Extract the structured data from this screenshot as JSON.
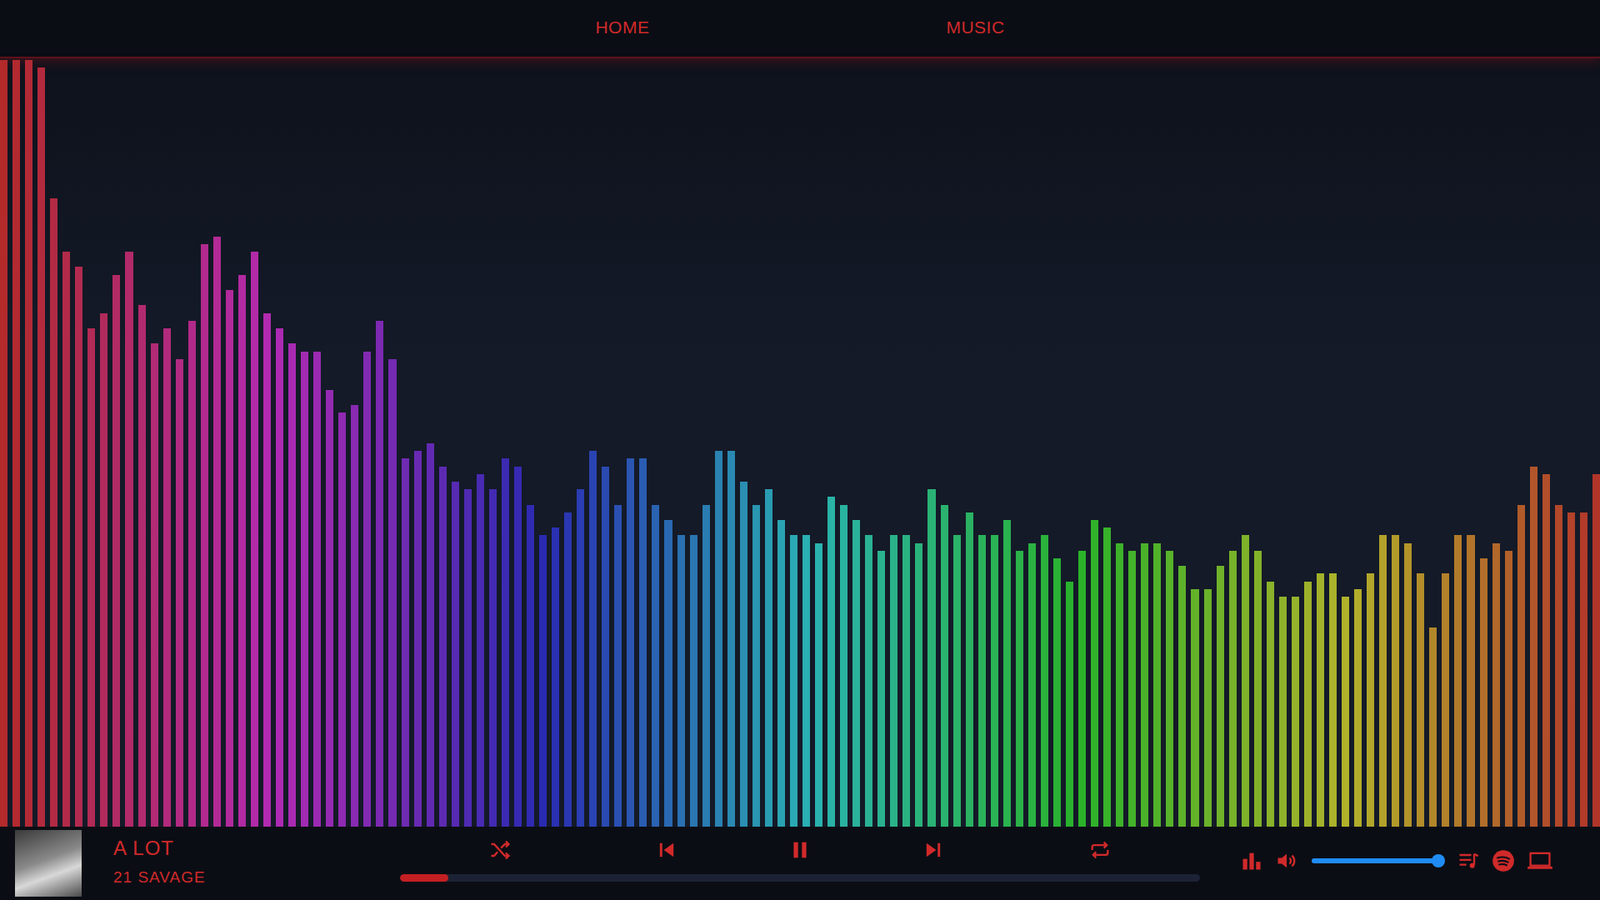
{
  "nav": {
    "items": [
      {
        "label": "HOME"
      },
      {
        "label": "MUSIC"
      }
    ]
  },
  "visualizer": {
    "values": [
      1.0,
      1.0,
      1.0,
      0.99,
      0.82,
      0.75,
      0.73,
      0.65,
      0.67,
      0.72,
      0.75,
      0.68,
      0.63,
      0.65,
      0.61,
      0.66,
      0.76,
      0.77,
      0.7,
      0.72,
      0.75,
      0.67,
      0.65,
      0.63,
      0.62,
      0.62,
      0.57,
      0.54,
      0.55,
      0.62,
      0.66,
      0.61,
      0.48,
      0.49,
      0.5,
      0.47,
      0.45,
      0.44,
      0.46,
      0.44,
      0.48,
      0.47,
      0.42,
      0.38,
      0.39,
      0.41,
      0.44,
      0.49,
      0.47,
      0.42,
      0.48,
      0.48,
      0.42,
      0.4,
      0.38,
      0.38,
      0.42,
      0.49,
      0.49,
      0.45,
      0.42,
      0.44,
      0.4,
      0.38,
      0.38,
      0.37,
      0.43,
      0.42,
      0.4,
      0.38,
      0.36,
      0.38,
      0.38,
      0.37,
      0.44,
      0.42,
      0.38,
      0.41,
      0.38,
      0.38,
      0.4,
      0.36,
      0.37,
      0.38,
      0.35,
      0.32,
      0.36,
      0.4,
      0.39,
      0.37,
      0.36,
      0.37,
      0.37,
      0.36,
      0.34,
      0.31,
      0.31,
      0.34,
      0.36,
      0.38,
      0.36,
      0.32,
      0.3,
      0.3,
      0.32,
      0.33,
      0.33,
      0.3,
      0.31,
      0.33,
      0.38,
      0.38,
      0.37,
      0.33,
      0.26,
      0.33,
      0.38,
      0.38,
      0.35,
      0.37,
      0.36,
      0.42,
      0.47,
      0.46,
      0.42,
      0.41,
      0.41,
      0.46
    ]
  },
  "player": {
    "title": "A LOT",
    "artist": "21 SAVAGE",
    "playing": true,
    "progress": {
      "level": 0.06
    },
    "volume": {
      "level": 1.0
    }
  }
}
